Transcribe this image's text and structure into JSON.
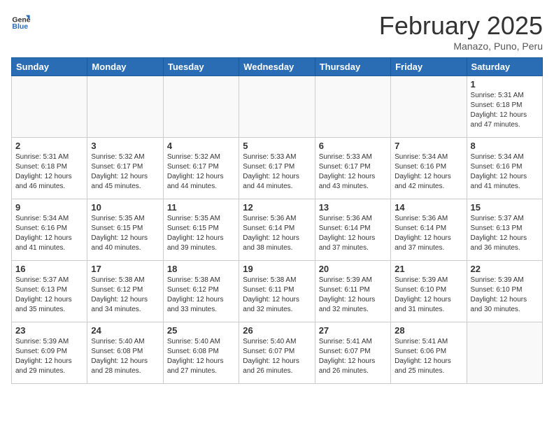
{
  "header": {
    "logo_general": "General",
    "logo_blue": "Blue",
    "month": "February 2025",
    "location": "Manazo, Puno, Peru"
  },
  "days_of_week": [
    "Sunday",
    "Monday",
    "Tuesday",
    "Wednesday",
    "Thursday",
    "Friday",
    "Saturday"
  ],
  "weeks": [
    [
      {
        "day": "",
        "info": ""
      },
      {
        "day": "",
        "info": ""
      },
      {
        "day": "",
        "info": ""
      },
      {
        "day": "",
        "info": ""
      },
      {
        "day": "",
        "info": ""
      },
      {
        "day": "",
        "info": ""
      },
      {
        "day": "1",
        "info": "Sunrise: 5:31 AM\nSunset: 6:18 PM\nDaylight: 12 hours\nand 47 minutes."
      }
    ],
    [
      {
        "day": "2",
        "info": "Sunrise: 5:31 AM\nSunset: 6:18 PM\nDaylight: 12 hours\nand 46 minutes."
      },
      {
        "day": "3",
        "info": "Sunrise: 5:32 AM\nSunset: 6:17 PM\nDaylight: 12 hours\nand 45 minutes."
      },
      {
        "day": "4",
        "info": "Sunrise: 5:32 AM\nSunset: 6:17 PM\nDaylight: 12 hours\nand 44 minutes."
      },
      {
        "day": "5",
        "info": "Sunrise: 5:33 AM\nSunset: 6:17 PM\nDaylight: 12 hours\nand 44 minutes."
      },
      {
        "day": "6",
        "info": "Sunrise: 5:33 AM\nSunset: 6:17 PM\nDaylight: 12 hours\nand 43 minutes."
      },
      {
        "day": "7",
        "info": "Sunrise: 5:34 AM\nSunset: 6:16 PM\nDaylight: 12 hours\nand 42 minutes."
      },
      {
        "day": "8",
        "info": "Sunrise: 5:34 AM\nSunset: 6:16 PM\nDaylight: 12 hours\nand 41 minutes."
      }
    ],
    [
      {
        "day": "9",
        "info": "Sunrise: 5:34 AM\nSunset: 6:16 PM\nDaylight: 12 hours\nand 41 minutes."
      },
      {
        "day": "10",
        "info": "Sunrise: 5:35 AM\nSunset: 6:15 PM\nDaylight: 12 hours\nand 40 minutes."
      },
      {
        "day": "11",
        "info": "Sunrise: 5:35 AM\nSunset: 6:15 PM\nDaylight: 12 hours\nand 39 minutes."
      },
      {
        "day": "12",
        "info": "Sunrise: 5:36 AM\nSunset: 6:14 PM\nDaylight: 12 hours\nand 38 minutes."
      },
      {
        "day": "13",
        "info": "Sunrise: 5:36 AM\nSunset: 6:14 PM\nDaylight: 12 hours\nand 37 minutes."
      },
      {
        "day": "14",
        "info": "Sunrise: 5:36 AM\nSunset: 6:14 PM\nDaylight: 12 hours\nand 37 minutes."
      },
      {
        "day": "15",
        "info": "Sunrise: 5:37 AM\nSunset: 6:13 PM\nDaylight: 12 hours\nand 36 minutes."
      }
    ],
    [
      {
        "day": "16",
        "info": "Sunrise: 5:37 AM\nSunset: 6:13 PM\nDaylight: 12 hours\nand 35 minutes."
      },
      {
        "day": "17",
        "info": "Sunrise: 5:38 AM\nSunset: 6:12 PM\nDaylight: 12 hours\nand 34 minutes."
      },
      {
        "day": "18",
        "info": "Sunrise: 5:38 AM\nSunset: 6:12 PM\nDaylight: 12 hours\nand 33 minutes."
      },
      {
        "day": "19",
        "info": "Sunrise: 5:38 AM\nSunset: 6:11 PM\nDaylight: 12 hours\nand 32 minutes."
      },
      {
        "day": "20",
        "info": "Sunrise: 5:39 AM\nSunset: 6:11 PM\nDaylight: 12 hours\nand 32 minutes."
      },
      {
        "day": "21",
        "info": "Sunrise: 5:39 AM\nSunset: 6:10 PM\nDaylight: 12 hours\nand 31 minutes."
      },
      {
        "day": "22",
        "info": "Sunrise: 5:39 AM\nSunset: 6:10 PM\nDaylight: 12 hours\nand 30 minutes."
      }
    ],
    [
      {
        "day": "23",
        "info": "Sunrise: 5:39 AM\nSunset: 6:09 PM\nDaylight: 12 hours\nand 29 minutes."
      },
      {
        "day": "24",
        "info": "Sunrise: 5:40 AM\nSunset: 6:08 PM\nDaylight: 12 hours\nand 28 minutes."
      },
      {
        "day": "25",
        "info": "Sunrise: 5:40 AM\nSunset: 6:08 PM\nDaylight: 12 hours\nand 27 minutes."
      },
      {
        "day": "26",
        "info": "Sunrise: 5:40 AM\nSunset: 6:07 PM\nDaylight: 12 hours\nand 26 minutes."
      },
      {
        "day": "27",
        "info": "Sunrise: 5:41 AM\nSunset: 6:07 PM\nDaylight: 12 hours\nand 26 minutes."
      },
      {
        "day": "28",
        "info": "Sunrise: 5:41 AM\nSunset: 6:06 PM\nDaylight: 12 hours\nand 25 minutes."
      },
      {
        "day": "",
        "info": ""
      }
    ]
  ]
}
